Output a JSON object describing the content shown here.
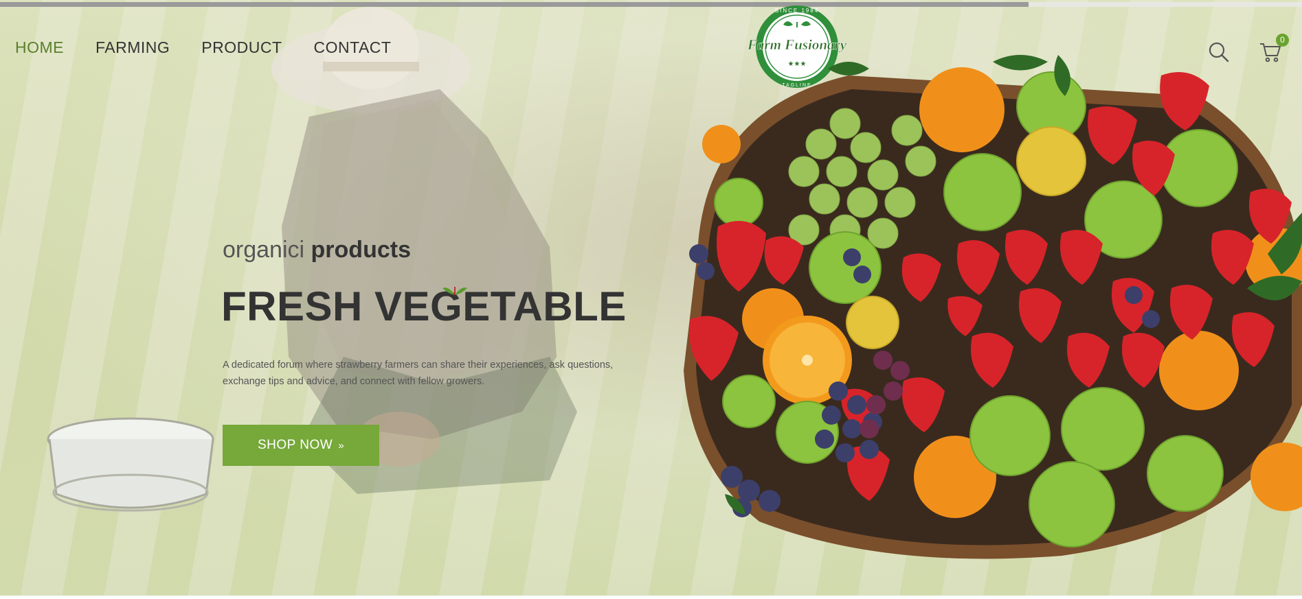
{
  "nav": {
    "items": [
      {
        "label": "HOME",
        "active": true
      },
      {
        "label": "FARMING",
        "active": false
      },
      {
        "label": "PRODUCT",
        "active": false
      },
      {
        "label": "CONTACT",
        "active": false
      }
    ]
  },
  "logo": {
    "name": "Farm Fusionary",
    "top_text": "SINCE 1984",
    "bottom_text": "TAGLINE",
    "stars": "★★★"
  },
  "header": {
    "search_icon": "search-icon",
    "cart_icon": "cart-icon",
    "cart_count": "0"
  },
  "scroll_progress": 0.79,
  "hero": {
    "subtitle_light": "organici",
    "subtitle_bold": "products",
    "headline": "FRESH VEGETABLE",
    "description": "A dedicated forum where strawberry farmers can share their experiences, ask questions, exchange tips and advice, and connect with fellow growers.",
    "cta_label": "SHOP NOW",
    "cta_arrow": "»"
  },
  "colors": {
    "accent": "#76a83a",
    "nav_active": "#5a7f2c",
    "text_dark": "#333333",
    "logo_green": "#2f8f3a"
  }
}
